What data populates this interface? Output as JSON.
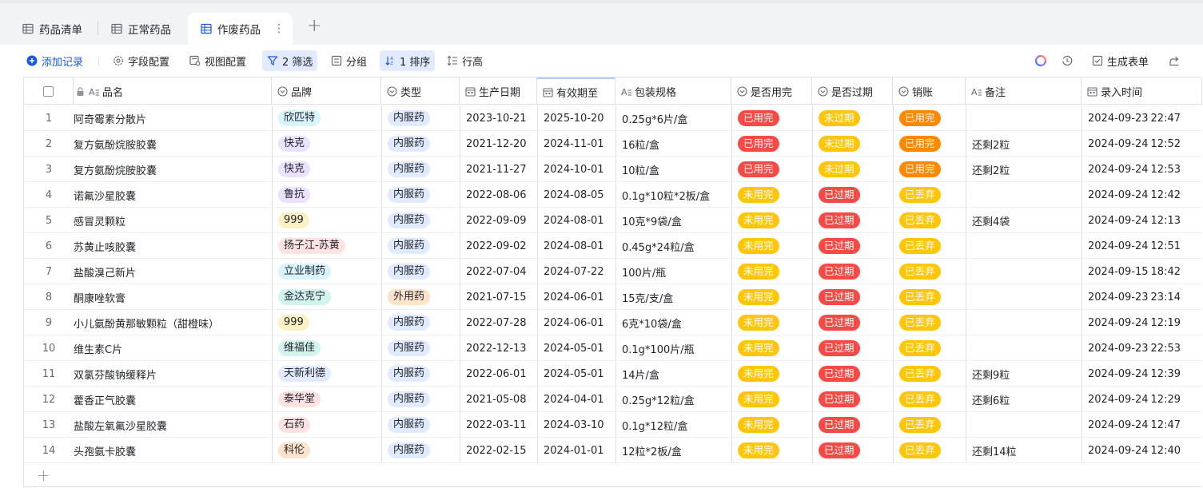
{
  "tabs": [
    {
      "label": "药品清单",
      "active": false
    },
    {
      "label": "正常药品",
      "active": false
    },
    {
      "label": "作废药品",
      "active": true
    }
  ],
  "tab_more": "⋮",
  "tab_add": "+",
  "toolbar": {
    "add_record": "添加记录",
    "field_config": "字段配置",
    "view_config": "视图配置",
    "filter": "2 筛选",
    "group": "分组",
    "sort": "1 排序",
    "row_height": "行高",
    "generate_form": "生成表单"
  },
  "columns": [
    "品名",
    "品牌",
    "类型",
    "生产日期",
    "有效期至",
    "包装规格",
    "是否用完",
    "是否过期",
    "销账",
    "备注",
    "录入时间"
  ],
  "tag_colors": {
    "欣匹特": {
      "bg": "#d9f3fd",
      "fg": "#1f2329"
    },
    "快克": {
      "bg": "#ece2fe",
      "fg": "#1f2329"
    },
    "鲁抗": {
      "bg": "#ece2fe",
      "fg": "#1f2329"
    },
    "999": {
      "bg": "#fcf1c4",
      "fg": "#1f2329"
    },
    "扬子江-苏黄": {
      "bg": "#fde2e2",
      "fg": "#1f2329"
    },
    "立业制药": {
      "bg": "#d9f3fd",
      "fg": "#1f2329"
    },
    "金达克宁": {
      "bg": "#d3f3ee",
      "fg": "#1f2329"
    },
    "维福佳": {
      "bg": "#d3f3ee",
      "fg": "#1f2329"
    },
    "天新利德": {
      "bg": "#e1eaff",
      "fg": "#1f2329"
    },
    "泰华堂": {
      "bg": "#fde2e2",
      "fg": "#1f2329"
    },
    "石药": {
      "bg": "#fde2e2",
      "fg": "#1f2329"
    },
    "科伦": {
      "bg": "#fde2cc",
      "fg": "#1f2329"
    },
    "内服药": {
      "bg": "#e1eaff",
      "fg": "#1f2329"
    },
    "外用药": {
      "bg": "#fde2cc",
      "fg": "#1f2329"
    }
  },
  "pill_colors": {
    "已用完": "#f54a45",
    "未用完": "#ffc60a",
    "未过期": "#ffc60a",
    "已过期": "#f54a45",
    "已丢弃": "#ffc60a",
    "已用完_writeoff": "#ff8800"
  },
  "rows": [
    {
      "n": "1",
      "name": "阿奇霉素分散片",
      "brand": "欣匹特",
      "type": "内服药",
      "mfg": "2023-10-21",
      "exp": "2025-10-20",
      "spec": "0.25g*6片/盒",
      "used": "已用完",
      "expired": "未过期",
      "writeoff": "已用完",
      "note": "",
      "date": "2024-09-23",
      "time": "22:47"
    },
    {
      "n": "2",
      "name": "复方氨酚烷胺胶囊",
      "brand": "快克",
      "type": "内服药",
      "mfg": "2021-12-20",
      "exp": "2024-11-01",
      "spec": "16粒/盒",
      "used": "已用完",
      "expired": "未过期",
      "writeoff": "已用完",
      "note": "还剩2粒",
      "date": "2024-09-24",
      "time": "12:52"
    },
    {
      "n": "3",
      "name": "复方氨酚烷胺胶囊",
      "brand": "快克",
      "type": "内服药",
      "mfg": "2021-11-27",
      "exp": "2024-10-01",
      "spec": "10粒/盒",
      "used": "已用完",
      "expired": "未过期",
      "writeoff": "已用完",
      "note": "还剩2粒",
      "date": "2024-09-24",
      "time": "12:53"
    },
    {
      "n": "4",
      "name": "诺氟沙星胶囊",
      "brand": "鲁抗",
      "type": "内服药",
      "mfg": "2022-08-06",
      "exp": "2024-08-05",
      "spec": "0.1g*10粒*2板/盒",
      "used": "未用完",
      "expired": "已过期",
      "writeoff": "已丢弃",
      "note": "",
      "date": "2024-09-24",
      "time": "12:42"
    },
    {
      "n": "5",
      "name": "感冒灵颗粒",
      "brand": "999",
      "type": "内服药",
      "mfg": "2022-09-09",
      "exp": "2024-08-01",
      "spec": "10克*9袋/盒",
      "used": "未用完",
      "expired": "已过期",
      "writeoff": "已丢弃",
      "note": "还剩4袋",
      "date": "2024-09-24",
      "time": "12:13"
    },
    {
      "n": "6",
      "name": "苏黄止咳胶囊",
      "brand": "扬子江-苏黄",
      "type": "内服药",
      "mfg": "2022-09-02",
      "exp": "2024-08-01",
      "spec": "0.45g*24粒/盒",
      "used": "未用完",
      "expired": "已过期",
      "writeoff": "已丢弃",
      "note": "",
      "date": "2024-09-24",
      "time": "12:51"
    },
    {
      "n": "7",
      "name": "盐酸溴己新片",
      "brand": "立业制药",
      "type": "内服药",
      "mfg": "2022-07-04",
      "exp": "2024-07-22",
      "spec": "100片/瓶",
      "used": "未用完",
      "expired": "已过期",
      "writeoff": "已丢弃",
      "note": "",
      "date": "2024-09-15",
      "time": "18:42"
    },
    {
      "n": "8",
      "name": "酮康唑软膏",
      "brand": "金达克宁",
      "type": "外用药",
      "mfg": "2021-07-15",
      "exp": "2024-06-01",
      "spec": "15克/支/盒",
      "used": "未用完",
      "expired": "已过期",
      "writeoff": "已丢弃",
      "note": "",
      "date": "2024-09-23",
      "time": "23:14"
    },
    {
      "n": "9",
      "name": "小儿氨酚黄那敏颗粒（甜橙味）",
      "brand": "999",
      "type": "内服药",
      "mfg": "2022-07-28",
      "exp": "2024-06-01",
      "spec": "6克*10袋/盒",
      "used": "未用完",
      "expired": "已过期",
      "writeoff": "已丢弃",
      "note": "",
      "date": "2024-09-24",
      "time": "12:19"
    },
    {
      "n": "10",
      "name": "维生素C片",
      "brand": "维福佳",
      "type": "内服药",
      "mfg": "2022-12-13",
      "exp": "2024-05-01",
      "spec": "0.1g*100片/瓶",
      "used": "未用完",
      "expired": "已过期",
      "writeoff": "已丢弃",
      "note": "",
      "date": "2024-09-23",
      "time": "22:53"
    },
    {
      "n": "11",
      "name": "双氯芬酸钠缓释片",
      "brand": "天新利德",
      "type": "内服药",
      "mfg": "2022-06-01",
      "exp": "2024-05-01",
      "spec": "14片/盒",
      "used": "未用完",
      "expired": "已过期",
      "writeoff": "已丢弃",
      "note": "还剩9粒",
      "date": "2024-09-24",
      "time": "12:39"
    },
    {
      "n": "12",
      "name": "藿香正气胶囊",
      "brand": "泰华堂",
      "type": "内服药",
      "mfg": "2021-05-08",
      "exp": "2024-04-01",
      "spec": "0.25g*12粒/盒",
      "used": "未用完",
      "expired": "已过期",
      "writeoff": "已丢弃",
      "note": "还剩6粒",
      "date": "2024-09-24",
      "time": "12:29"
    },
    {
      "n": "13",
      "name": "盐酸左氧氟沙星胶囊",
      "brand": "石药",
      "type": "内服药",
      "mfg": "2022-03-11",
      "exp": "2024-03-10",
      "spec": "0.1g*12粒/盒",
      "used": "未用完",
      "expired": "已过期",
      "writeoff": "已丢弃",
      "note": "",
      "date": "2024-09-24",
      "time": "12:47"
    },
    {
      "n": "14",
      "name": "头孢氨卡胶囊",
      "brand": "科伦",
      "type": "内服药",
      "mfg": "2022-02-15",
      "exp": "2024-01-01",
      "spec": "12粒*2板/盒",
      "used": "未用完",
      "expired": "已过期",
      "writeoff": "已丢弃",
      "note": "还剩14粒",
      "date": "2024-09-24",
      "time": "12:40"
    }
  ],
  "add_row": "+"
}
